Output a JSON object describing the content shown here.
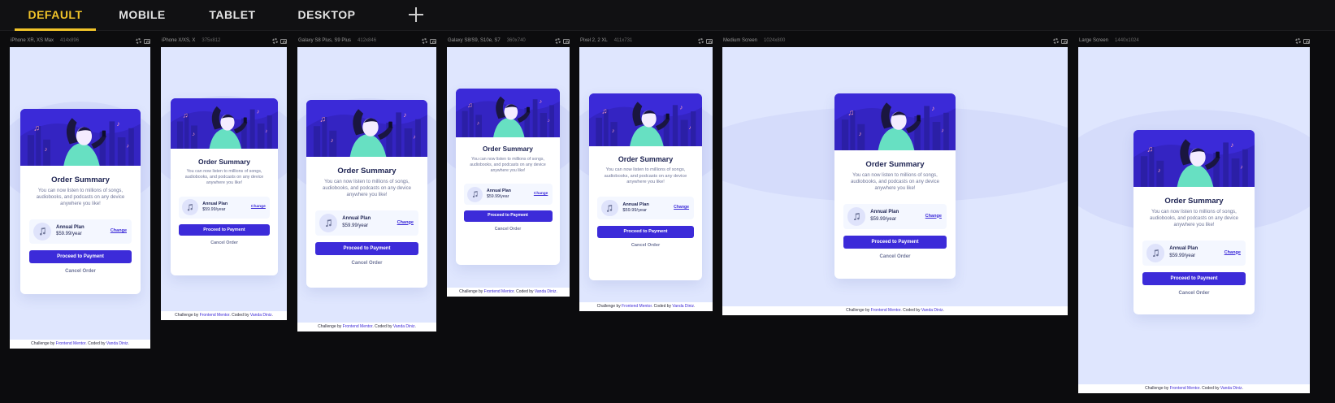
{
  "tabs": [
    {
      "label": "DEFAULT",
      "active": true
    },
    {
      "label": "MOBILE",
      "active": false
    },
    {
      "label": "TABLET",
      "active": false
    },
    {
      "label": "DESKTOP",
      "active": false
    }
  ],
  "order": {
    "title": "Order Summary",
    "description": "You can now listen to millions of songs, audiobooks, and podcasts on any device anywhere you like!",
    "plan_name": "Annual Plan",
    "plan_price": "$59.99/year",
    "change_label": "Change",
    "pay_label": "Proceed to Payment",
    "cancel_label": "Cancel Order"
  },
  "footer": {
    "prefix": "Challenge by",
    "fm": "Frontend Mentor",
    "mid": ". Coded by",
    "author": "Vanda Diniz",
    "suffix": "."
  },
  "devices": [
    {
      "name": "iPhone XR, XS Max",
      "dims": "414x896"
    },
    {
      "name": "iPhone X/XS, X",
      "dims": "375x812"
    },
    {
      "name": "Galaxy S8 Plus, S9 Plus",
      "dims": "412x846"
    },
    {
      "name": "Galaxy S8/S9, S10e, S7",
      "dims": "360x740"
    },
    {
      "name": "Pixel 2, 2 XL",
      "dims": "411x731"
    },
    {
      "name": "Medium Screen",
      "dims": "1024x800"
    },
    {
      "name": "Large Screen",
      "dims": "1440x1024"
    }
  ],
  "colors": {
    "accent": "#f0c329",
    "brand": "#3c2bd9",
    "background": "#dfe6fe",
    "title": "#1c2251",
    "text": "#6f7699"
  },
  "icons": [
    "plus-icon",
    "gear-icon",
    "camera-icon",
    "music-note-icon"
  ]
}
